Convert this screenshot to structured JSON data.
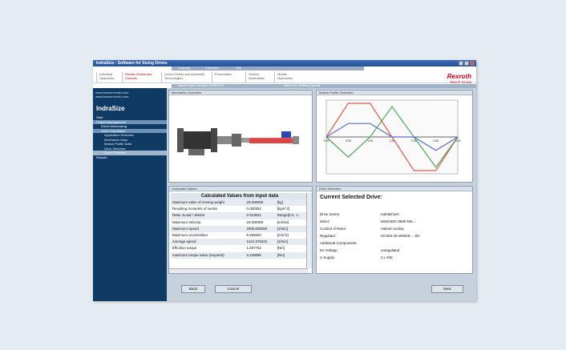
{
  "window": {
    "title": "IndraSize - Software for Sizing Drives"
  },
  "menubar": {
    "items": [
      "Language",
      "Extensions",
      "Help"
    ]
  },
  "header": {
    "nav": [
      "Industrial Hydraulics",
      "Electric Drives and Controls",
      "Linear Motion and Assembly Technologies",
      "Pneumatics",
      "Service Automation",
      "Mobile Hydraulics"
    ],
    "logo": {
      "line1": "Rexroth",
      "line2": "Bosch Group"
    }
  },
  "breadcrumb": {
    "left": "Active Project: Example_DEMO2017",
    "right": "Active Axis: Rotating_Spindle"
  },
  "sidebar": {
    "links": [
      "www.boschrexroth.com",
      "www.boschrexroth.com"
    ],
    "app_name": "IndraSize",
    "items": [
      {
        "label": "Start",
        "level": 0
      },
      {
        "label": "Project Management",
        "level": 0,
        "selected": true
      },
      {
        "label": "Direct Motorsizing",
        "level": 1
      },
      {
        "label": "Drive Calculation",
        "level": 1,
        "selected": true
      },
      {
        "label": "Application Selection",
        "level": 2
      },
      {
        "label": "Mechanics Data",
        "level": 2
      },
      {
        "label": "Motion Profile Data",
        "level": 2
      },
      {
        "label": "Drive Selection",
        "level": 2
      },
      {
        "label": "Drive Overview",
        "level": 2,
        "current": true
      },
      {
        "label": "Results",
        "level": 0
      }
    ]
  },
  "panels": {
    "mechanics": "Mechanics Overview",
    "motion": "Motion Profile Overview",
    "computed": "Computed Values",
    "drive": "Drive Selection"
  },
  "computed": {
    "header": "Calculated Values from input data",
    "rows": [
      [
        "Maximum value of moving weight",
        "25.000000",
        "[kg]"
      ],
      [
        "Resulting moments of inertia",
        "0.000352",
        "[kgm^2]"
      ],
      [
        "Ratio JLoad / JMotor",
        "2.013641",
        "Range[0,0...1"
      ],
      [
        "Maximum Velocity",
        "20.000000",
        "[m/min]"
      ],
      [
        "Maximum Speed",
        "2000.000000",
        "[1/min]"
      ],
      [
        "Maximum acceleration",
        "8.455822",
        "[m/s^2]"
      ],
      [
        "Average speed",
        "1241.379310",
        "[1/min]"
      ],
      [
        "Effective torque",
        "1.697752",
        "[Nm]"
      ],
      [
        "maximum torque value (required)",
        "3.248895",
        "[Nm]"
      ]
    ]
  },
  "drive": {
    "title": "Current Selected Drive:",
    "rows": [
      [
        "Drive Series:",
        "IndraDriveC"
      ],
      [
        "Motor:",
        "MSK040C-0600-NN-..."
      ],
      [
        "Coolind of Motor:",
        "natural cooling"
      ],
      [
        "Regulator:",
        "HCS02.1E-W0028-...-03-"
      ],
      [
        "Additional Components:",
        ""
      ],
      [
        "Dc-Voltage:",
        "unregulated"
      ],
      [
        "U Supply:",
        "3 x 400"
      ]
    ]
  },
  "buttons": {
    "back": "Back",
    "cancel": "Cancel",
    "next": "Next"
  },
  "chart_data": {
    "type": "line",
    "title": "",
    "x_tick_labels": [
      "0.00",
      "0.50",
      "1.00",
      "1.50",
      "2.00",
      "2.50",
      "3.00"
    ],
    "series": [
      {
        "color": "#e05a4a",
        "values": [
          0,
          20,
          20,
          0,
          -20,
          -20,
          0
        ]
      },
      {
        "color": "#49a85a",
        "values": [
          0,
          -12,
          0,
          18,
          0,
          -18,
          0
        ]
      },
      {
        "color": "#5a6fd0",
        "values": [
          0,
          8,
          8,
          0,
          0,
          -8,
          0
        ]
      }
    ]
  }
}
